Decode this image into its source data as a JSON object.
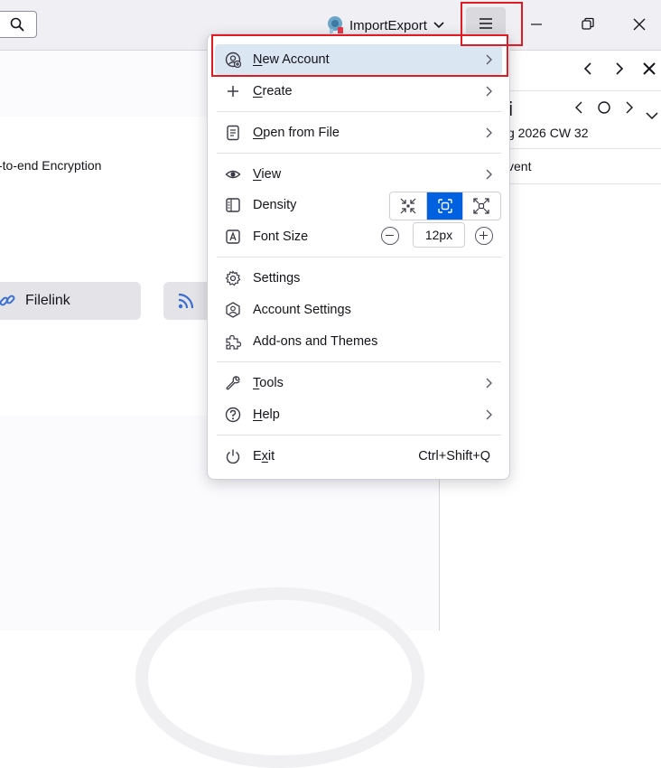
{
  "titlebar": {
    "profile_name": "ImportExport"
  },
  "background": {
    "encryption_text": "-to-end Encryption",
    "filelink_label": "Filelink"
  },
  "right_pane": {
    "title": "i",
    "week_text": "g 2026 CW 32",
    "event_text": "vent"
  },
  "menu": {
    "new_account": {
      "access": "N",
      "rest": "ew Account"
    },
    "create": {
      "access": "C",
      "rest": "reate"
    },
    "open_from_file": {
      "access": "O",
      "rest": "pen from File"
    },
    "view": {
      "access": "V",
      "rest": "iew"
    },
    "density": "Density",
    "font_size": "Font Size",
    "font_size_value": "12px",
    "settings": "Settings",
    "account_settings": "Account Settings",
    "addons_themes": "Add-ons and Themes",
    "tools": {
      "access": "T",
      "rest": "ools"
    },
    "help": {
      "access": "H",
      "rest": "elp"
    },
    "exit": {
      "access": "x",
      "pre": "E",
      "rest": "it"
    },
    "exit_shortcut": "Ctrl+Shift+Q",
    "density_options": [
      "compact",
      "normal",
      "touch"
    ],
    "density_selected": "normal"
  },
  "colors": {
    "accent": "#0061e0",
    "highlight_red": "#e01b24",
    "hover": "#dbe6f3"
  }
}
